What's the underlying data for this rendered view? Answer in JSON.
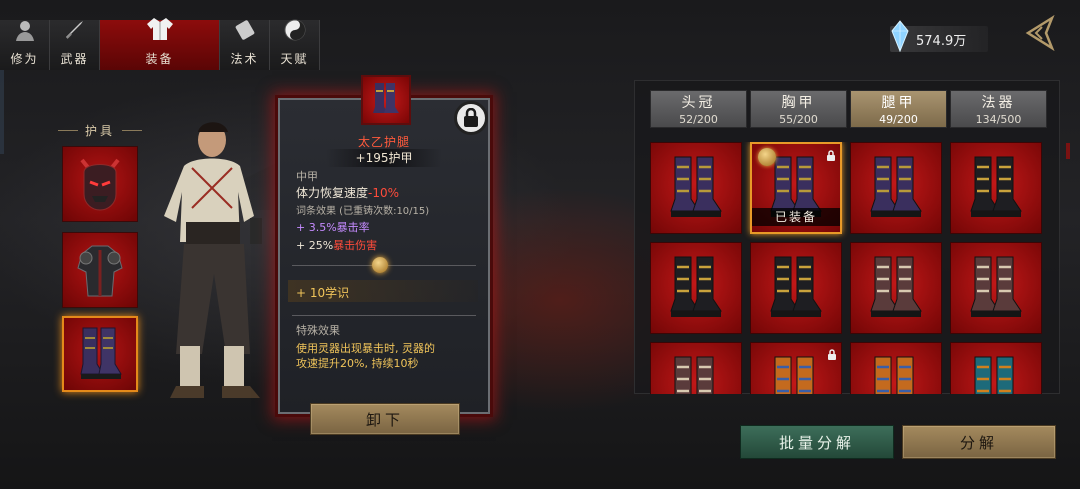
{
  "top_tabs": [
    {
      "label": "修为",
      "icon": "portrait-icon",
      "active": false
    },
    {
      "label": "武器",
      "icon": "sword-icon",
      "active": false
    },
    {
      "label": "装备",
      "icon": "robe-icon",
      "active": true
    },
    {
      "label": "法术",
      "icon": "scroll-icon",
      "active": false
    },
    {
      "label": "天赋",
      "icon": "yin-yang-icon",
      "active": false
    }
  ],
  "currency": {
    "amount": "574.9万",
    "icon": "crystal-gem-icon"
  },
  "armor_slots": {
    "label": "护具",
    "slots": [
      {
        "icon": "demon-mask-icon",
        "selected": false
      },
      {
        "icon": "chest-armor-icon",
        "selected": false
      },
      {
        "icon": "boots-icon",
        "selected": true
      }
    ]
  },
  "item": {
    "name": "太乙护腿",
    "armor": "+195护甲",
    "grade": "中甲",
    "stat_label": "体力恢复速度",
    "stat_value": "-10%",
    "affix_title": "词条效果  (已重铸次数:10/15)",
    "affix_1": "+ 3.5%暴击率",
    "affix_2_prefix": "+ 25%",
    "affix_2_suffix": "暴击伤害",
    "xueshi": "+ 10学识",
    "special_title": "特殊效果",
    "special_line_1": "使用灵器出现暴击时, 灵器的",
    "special_line_2": "攻速提升20%, 持续10秒",
    "unequip_label": "卸下"
  },
  "inventory_tabs": [
    {
      "label": "头冠",
      "count": "52/200",
      "active": false
    },
    {
      "label": "胸甲",
      "count": "55/200",
      "active": false
    },
    {
      "label": "腿甲",
      "count": "49/200",
      "active": true
    },
    {
      "label": "法器",
      "count": "134/500",
      "active": false
    }
  ],
  "inventory_items": [
    {
      "type": "purple-boots",
      "equipped": false,
      "locked": false
    },
    {
      "type": "purple-boots",
      "equipped": true,
      "locked": true,
      "label": "已装备"
    },
    {
      "type": "purple-boots",
      "equipped": false,
      "locked": false
    },
    {
      "type": "black-gold-boots",
      "equipped": false,
      "locked": false
    },
    {
      "type": "black-gold-boots",
      "equipped": false,
      "locked": false
    },
    {
      "type": "black-gold-boots",
      "equipped": false,
      "locked": false
    },
    {
      "type": "red-bandaged-boots",
      "equipped": false,
      "locked": false
    },
    {
      "type": "red-bandaged-boots",
      "equipped": false,
      "locked": false
    },
    {
      "type": "red-bandaged-boots",
      "equipped": false,
      "locked": false
    },
    {
      "type": "orange-blue-boots",
      "equipped": false,
      "locked": true
    },
    {
      "type": "orange-blue-boots",
      "equipped": false,
      "locked": false
    },
    {
      "type": "teal-orange-boots",
      "equipped": false,
      "locked": false
    }
  ],
  "equipped_label": "已装备",
  "buttons": {
    "batch_dismantle": "批量分解",
    "dismantle": "分解"
  },
  "colors": {
    "accent_red": "#b31414",
    "equipped_border": "#e89a28",
    "tab_active": "#8d0c0c",
    "green_button": "#3d6e5a",
    "tan_button": "#a48a5e"
  }
}
